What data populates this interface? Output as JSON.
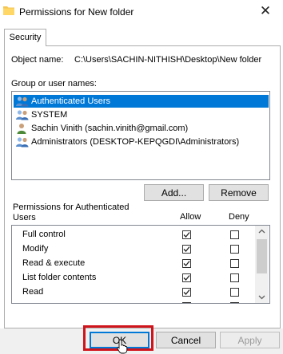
{
  "window": {
    "title": "Permissions for New folder"
  },
  "tabs": [
    {
      "label": "Security"
    }
  ],
  "object": {
    "label": "Object name:",
    "value": "C:\\Users\\SACHIN-NITHISH\\Desktop\\New folder"
  },
  "groups": {
    "label": "Group or user names:",
    "items": [
      {
        "label": "Authenticated Users",
        "icon": "user-group-icon",
        "selected": true
      },
      {
        "label": "SYSTEM",
        "icon": "user-group-icon",
        "selected": false
      },
      {
        "label": "Sachin Vinith (sachin.vinith@gmail.com)",
        "icon": "user-icon",
        "selected": false
      },
      {
        "label": "Administrators (DESKTOP-KEPQGDI\\Administrators)",
        "icon": "user-group-icon",
        "selected": false
      }
    ],
    "add_label": "Add...",
    "remove_label": "Remove"
  },
  "permissions": {
    "label": "Permissions for Authenticated Users",
    "allow_header": "Allow",
    "deny_header": "Deny",
    "rows": [
      {
        "name": "Full control",
        "allow": true,
        "deny": false
      },
      {
        "name": "Modify",
        "allow": true,
        "deny": false
      },
      {
        "name": "Read & execute",
        "allow": true,
        "deny": false
      },
      {
        "name": "List folder contents",
        "allow": true,
        "deny": false
      },
      {
        "name": "Read",
        "allow": true,
        "deny": false
      }
    ]
  },
  "footer": {
    "ok_label": "OK",
    "cancel_label": "Cancel",
    "apply_label": "Apply"
  },
  "colors": {
    "selection": "#0078d7",
    "highlight_box": "#d0141b",
    "button_bg": "#e1e1e1"
  }
}
